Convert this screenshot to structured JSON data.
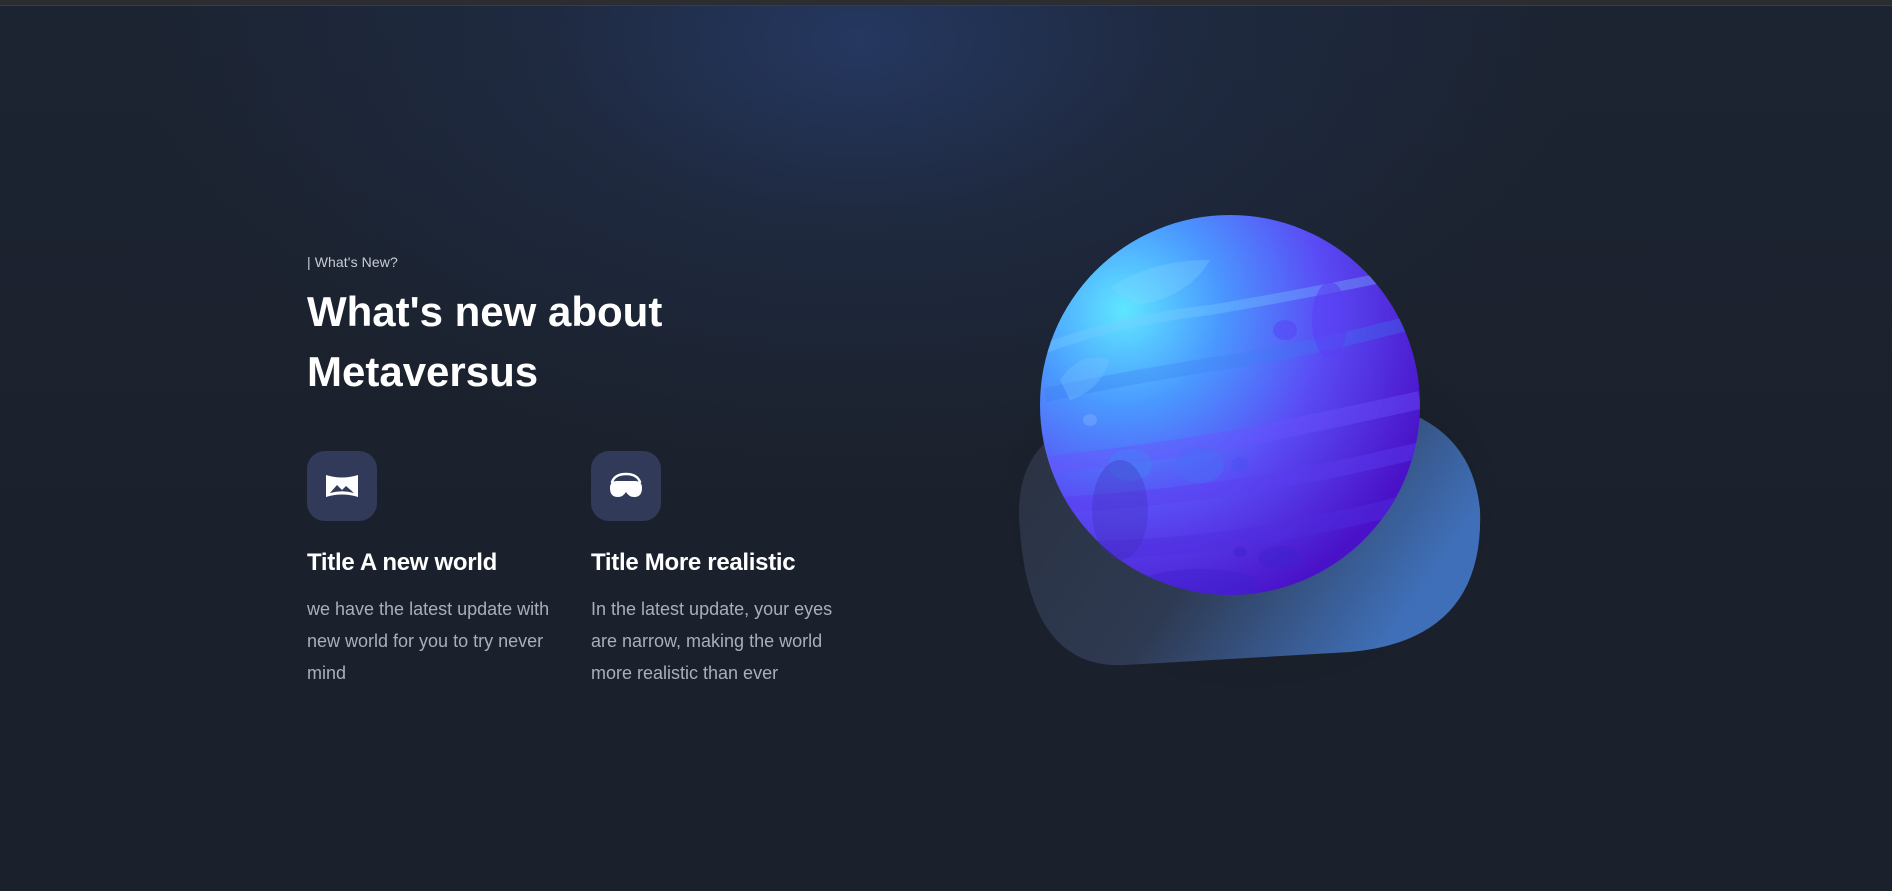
{
  "section": {
    "eyebrow": "| What's New?",
    "heading_line1": "What's new about",
    "heading_line2": "Metaversus"
  },
  "features": [
    {
      "icon": "landscape-image-icon",
      "title": "Title A new world",
      "text": "we have the latest update with new world for you to try never mind"
    },
    {
      "icon": "vr-headset-icon",
      "title": "Title More realistic",
      "text": "In the latest update, your eyes are narrow, making the world more realistic than ever"
    }
  ],
  "colors": {
    "background": "#1b212c",
    "icon_tile": "#323a5a",
    "planet_light": "#5fdcff",
    "planet_dark": "#4b1fd8",
    "blob": "#3f6fb8"
  }
}
